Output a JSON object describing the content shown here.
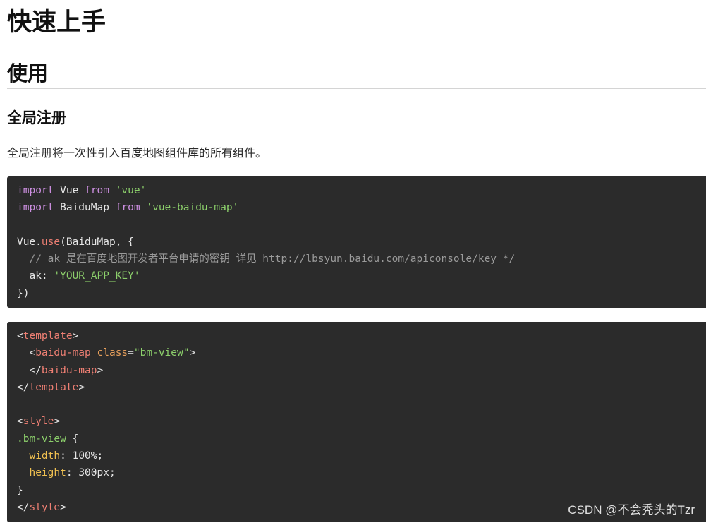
{
  "doc": {
    "title": "快速上手",
    "section": "使用",
    "subsection": "全局注册",
    "description": "全局注册将一次性引入百度地图组件库的所有组件。"
  },
  "code_js": {
    "l1": {
      "t1": "import",
      "t2": " Vue ",
      "t3": "from",
      "t4": " ",
      "t5": "'vue'"
    },
    "l2": {
      "t1": "import",
      "t2": " BaiduMap ",
      "t3": "from",
      "t4": " ",
      "t5": "'vue-baidu-map'"
    },
    "l4": {
      "t1": "Vue.",
      "t2": "use",
      "t3": "(BaiduMap, {"
    },
    "l5": {
      "t1": "  // ak 是在百度地图开发者平台申请的密钥 详见 http://lbsyun.baidu.com/apiconsole/key */"
    },
    "l6": {
      "t1": "  ak: ",
      "t2": "'YOUR_APP_KEY'"
    },
    "l7": {
      "t1": "})"
    }
  },
  "code_vue": {
    "l1": {
      "t1": "<",
      "t2": "template",
      "t3": ">"
    },
    "l2": {
      "t1": "  <",
      "t2": "baidu-map",
      "t3": " ",
      "t4": "class",
      "t5": "=",
      "t6": "\"bm-view\"",
      "t7": ">"
    },
    "l3": {
      "t1": "  </",
      "t2": "baidu-map",
      "t3": ">"
    },
    "l4": {
      "t1": "</",
      "t2": "template",
      "t3": ">"
    },
    "l6": {
      "t1": "<",
      "t2": "style",
      "t3": ">"
    },
    "l7": {
      "t1": ".bm-view",
      "t2": " {"
    },
    "l8": {
      "t1": "  ",
      "t2": "width",
      "t3": ": 100%;"
    },
    "l9": {
      "t1": "  ",
      "t2": "height",
      "t3": ": 300px;"
    },
    "l10": {
      "t1": "}"
    },
    "l11": {
      "t1": "</",
      "t2": "style",
      "t3": ">"
    }
  },
  "watermark": "CSDN @不会秃头的Tzr"
}
